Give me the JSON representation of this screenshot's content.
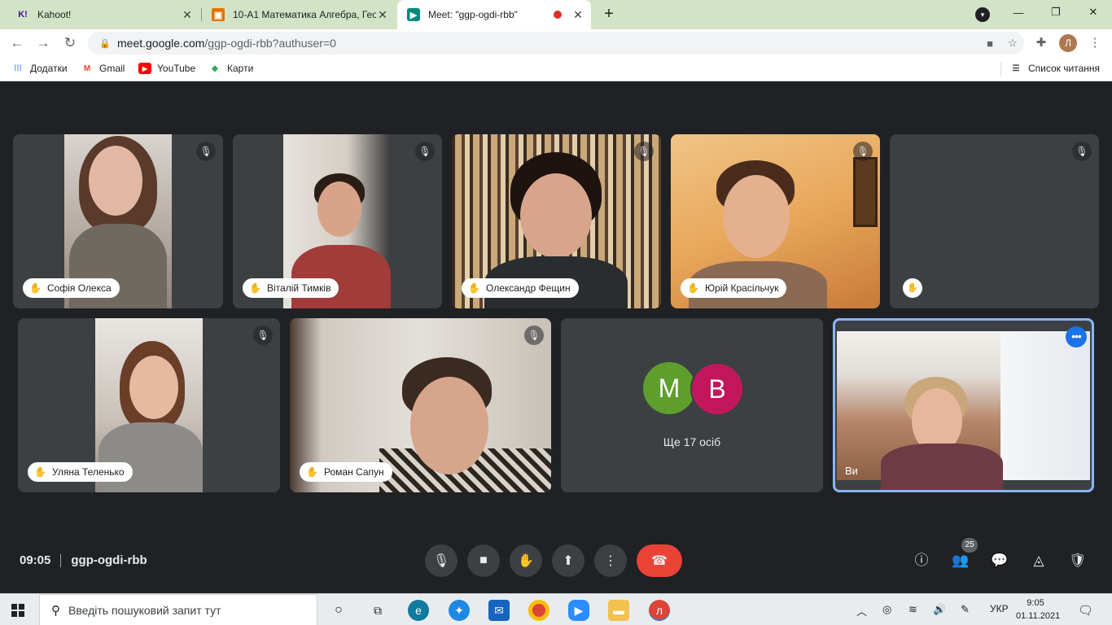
{
  "browser": {
    "tabs": [
      {
        "title": "Kahoot!",
        "favicon": "kahoot-icon",
        "color": "#46178f"
      },
      {
        "title": "10-А1 Математика Алгебра, Гео",
        "favicon": "classroom-icon",
        "color": "#e37400"
      },
      {
        "title": "Meet: \"ggp-ogdi-rbb\"",
        "favicon": "meet-icon",
        "color": "#00897b",
        "recording": true
      }
    ],
    "url_host": "meet.google.com",
    "url_path": "/ggp-ogdi-rbb?authuser=0",
    "profile_initial": "Л",
    "bookmarks": [
      {
        "label": "Додатки",
        "icon": "apps-grid-icon"
      },
      {
        "label": "Gmail",
        "icon": "gmail-icon"
      },
      {
        "label": "YouTube",
        "icon": "youtube-icon"
      },
      {
        "label": "Карти",
        "icon": "maps-icon"
      }
    ],
    "reading_list": "Список читання"
  },
  "meet": {
    "participants_row1": [
      {
        "name": "Софія Олекса"
      },
      {
        "name": "Віталій Тимків"
      },
      {
        "name": "Олександр Фещин"
      },
      {
        "name": "Юрій Красільчук"
      }
    ],
    "participants_row2": [
      {
        "name": "Уляна Теленько"
      },
      {
        "name": "Роман Сапун"
      }
    ],
    "more_tile": {
      "avatar1": "M",
      "avatar1_color": "#5e9e2d",
      "avatar2": "B",
      "avatar2_color": "#c2185b",
      "count_label": "Ще 17 осіб"
    },
    "self_label": "Ви",
    "time": "09:05",
    "meeting_code": "ggp-ogdi-rbb",
    "participant_count": "25"
  },
  "taskbar": {
    "search_placeholder": "Введіть пошуковий запит тут",
    "language": "УКР",
    "time": "9:05",
    "date": "01.11.2021"
  }
}
